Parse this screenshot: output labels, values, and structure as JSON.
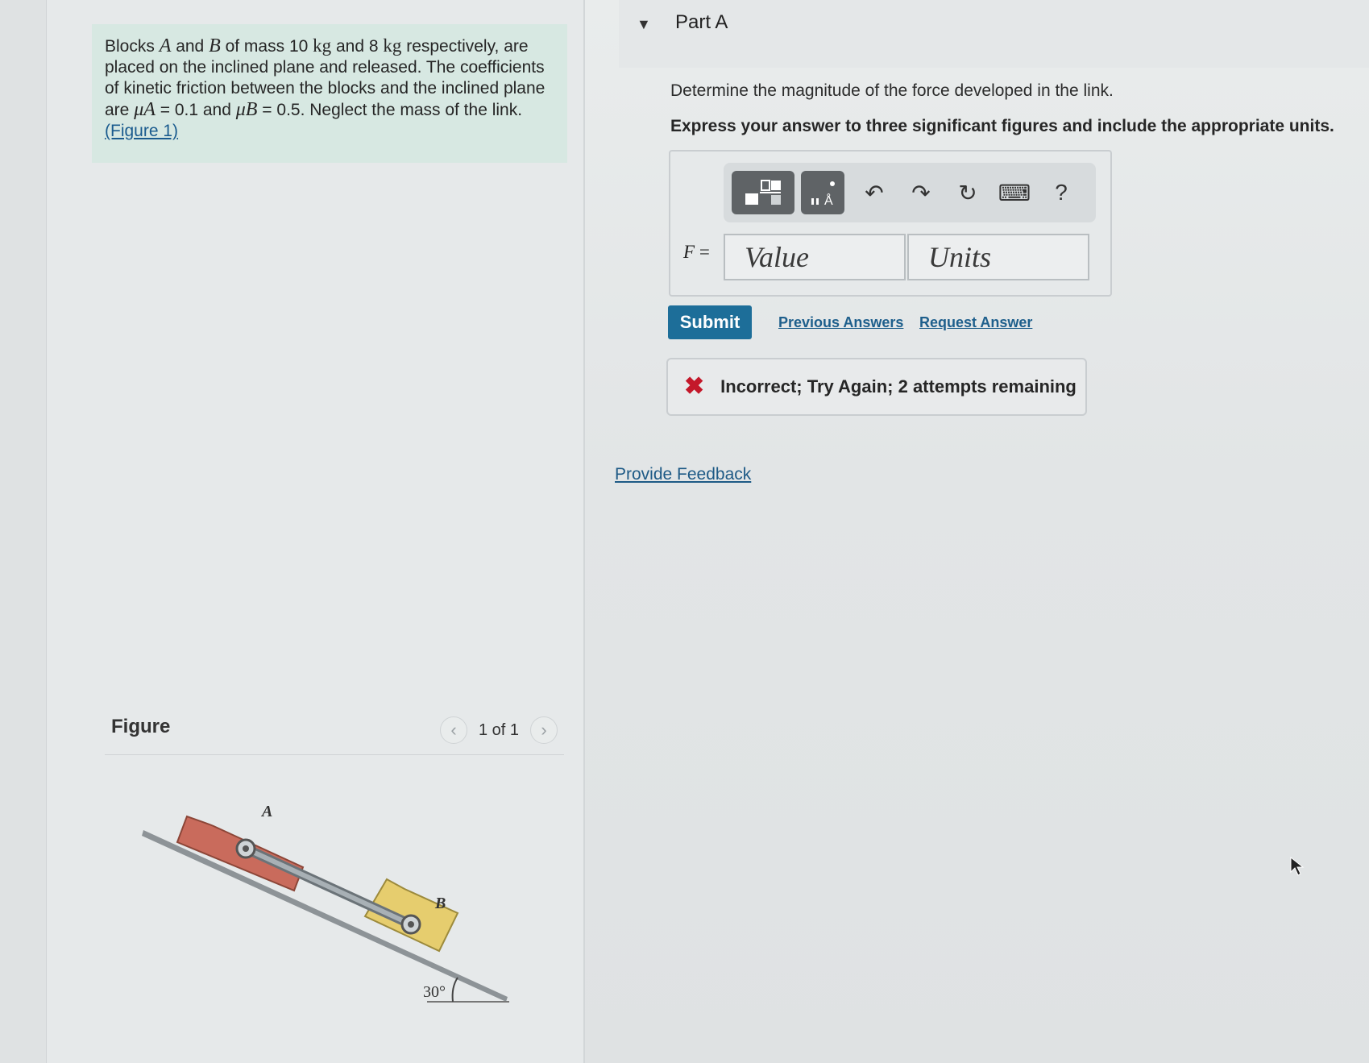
{
  "problem": {
    "t1": "Blocks ",
    "varA": "A",
    "t2": " and ",
    "varB": "B",
    "t3": " of mass 10 ",
    "unit1": "kg",
    "t4": " and 8 ",
    "unit2": "kg",
    "t5": " respectively, are placed on the inclined plane and released. The coefficients of kinetic friction between the blocks and the inclined plane are ",
    "muA": "μA",
    "t6": " = 0.1 and ",
    "muB": "μB",
    "t7": " = 0.5. Neglect the mass of the link. ",
    "figure_link": "(Figure 1)"
  },
  "figure": {
    "title": "Figure",
    "pager": "1 of 1",
    "prev_icon": "chevron-left-icon",
    "next_icon": "chevron-right-icon",
    "label_a": "A",
    "label_b": "B",
    "angle": "30°",
    "colors": {
      "block_a": "#c96b5c",
      "block_b": "#e6cd6e",
      "link": "#9aa3a8"
    }
  },
  "part": {
    "title": "Part A",
    "question": "Determine the magnitude of the force developed in the link.",
    "instruction": "Express your answer to three significant figures and include the appropriate units."
  },
  "toolbar": {
    "icons": [
      "templates-icon",
      "units-templates-icon",
      "undo-icon",
      "redo-icon",
      "reset-icon",
      "keyboard-icon",
      "help-icon"
    ],
    "help_label": "?"
  },
  "answer": {
    "label_var": "F",
    "label_eq": " =",
    "value_placeholder": "Value",
    "units_placeholder": "Units"
  },
  "actions": {
    "submit": "Submit",
    "previous": "Previous Answers",
    "request": "Request Answer"
  },
  "feedback": {
    "icon": "x-icon",
    "message": "Incorrect; Try Again; 2 attempts remaining",
    "color": "#c4182a"
  },
  "provide_feedback": "Provide Feedback",
  "colors": {
    "accent": "#1d6e99",
    "link": "#1e5f8c",
    "intro_bg": "#d7e8e2"
  }
}
